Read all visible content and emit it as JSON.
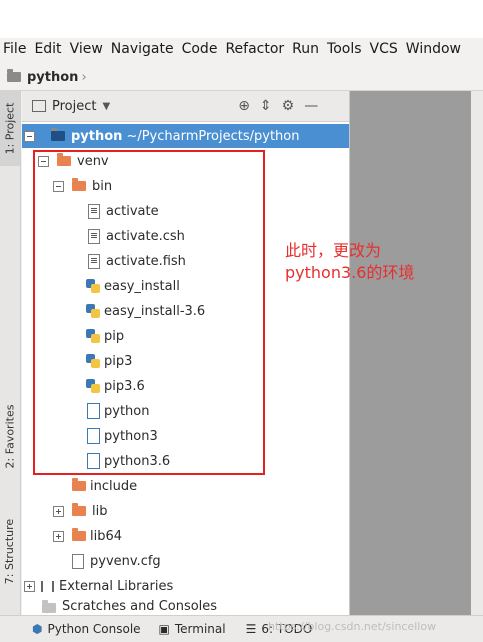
{
  "menu": [
    "File",
    "Edit",
    "View",
    "Navigate",
    "Code",
    "Refactor",
    "Run",
    "Tools",
    "VCS",
    "Window"
  ],
  "breadcrumb": {
    "project": "python"
  },
  "sidebar_tabs": {
    "project": "1: Project",
    "favorites": "2: Favorites",
    "structure": "7: Structure"
  },
  "panel": {
    "title": "Project"
  },
  "tree": {
    "root_name": "python",
    "root_path": "~/PycharmProjects/python",
    "venv": "venv",
    "bin": "bin",
    "bin_files": [
      "activate",
      "activate.csh",
      "activate.fish",
      "easy_install",
      "easy_install-3.6",
      "pip",
      "pip3",
      "pip3.6",
      "python",
      "python3",
      "python3.6"
    ],
    "include": "include",
    "lib": "lib",
    "lib64": "lib64",
    "pyvenv": "pyvenv.cfg",
    "external": "External Libraries",
    "scratches": "Scratches and Consoles"
  },
  "annotation": {
    "line1": "此时，更改为",
    "line2": "python3.6的环境"
  },
  "bottom": {
    "console": "Python Console",
    "terminal": "Terminal",
    "todo": "6: TODO"
  },
  "watermark": "https://blog.csdn.net/sincellow"
}
